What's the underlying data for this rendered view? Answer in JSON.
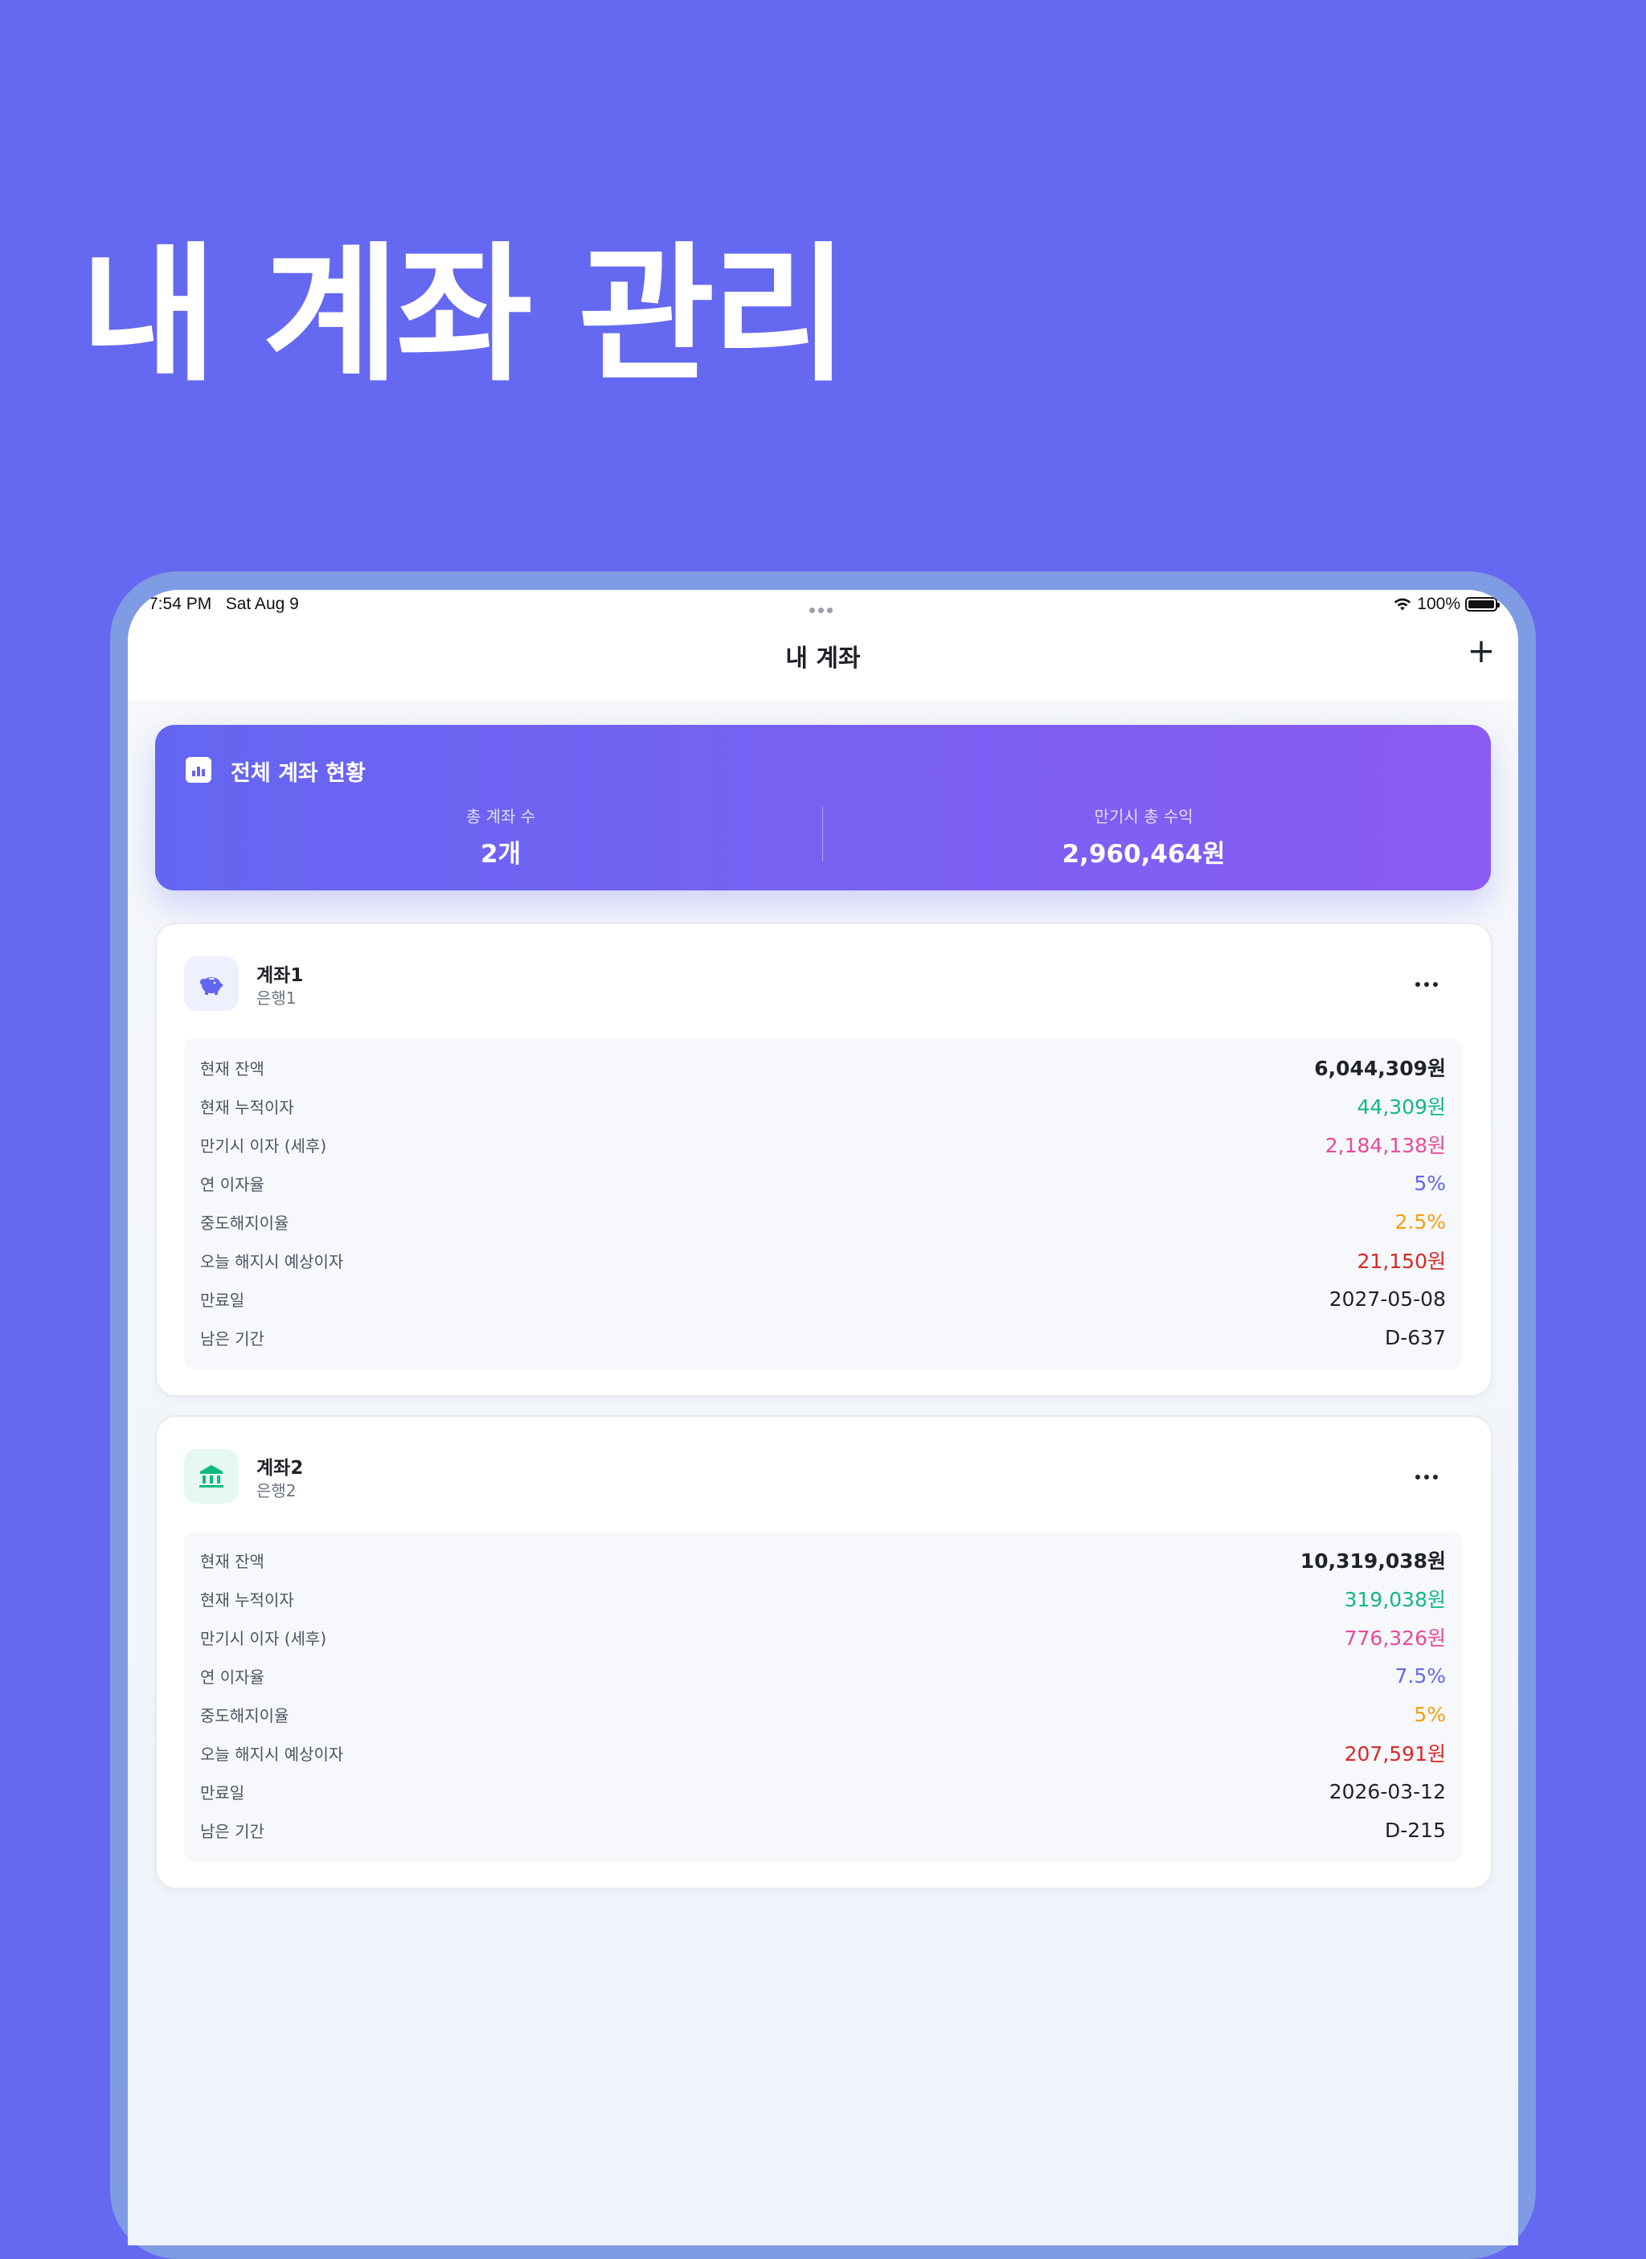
{
  "headline": "내 계좌 관리",
  "status_bar": {
    "time": "7:54 PM",
    "date": "Sat Aug 9",
    "battery": "100%"
  },
  "nav": {
    "title": "내 계좌",
    "add_label": "+"
  },
  "summary": {
    "title": "전체 계좌 현황",
    "total_accounts_label": "총 계좌 수",
    "total_accounts_value": "2개",
    "total_profit_label": "만기시 총 수익",
    "total_profit_value": "2,960,464원"
  },
  "accounts": [
    {
      "name": "계좌1",
      "bank": "은행1",
      "icon": "piggy-bank-icon",
      "rows": [
        {
          "label": "현재 잔액",
          "value": "6,044,309원"
        },
        {
          "label": "현재 누적이자",
          "value": "44,309원"
        },
        {
          "label": "만기시 이자 (세후)",
          "value": "2,184,138원"
        },
        {
          "label": "연 이자율",
          "value": "5%"
        },
        {
          "label": "중도해지이율",
          "value": "2.5%"
        },
        {
          "label": "오늘 해지시 예상이자",
          "value": "21,150원"
        },
        {
          "label": "만료일",
          "value": "2027-05-08"
        },
        {
          "label": "남은 기간",
          "value": "D-637"
        }
      ]
    },
    {
      "name": "계좌2",
      "bank": "은행2",
      "icon": "bank-building-icon",
      "rows": [
        {
          "label": "현재 잔액",
          "value": "10,319,038원"
        },
        {
          "label": "현재 누적이자",
          "value": "319,038원"
        },
        {
          "label": "만기시 이자 (세후)",
          "value": "776,326원"
        },
        {
          "label": "연 이자율",
          "value": "7.5%"
        },
        {
          "label": "중도해지이율",
          "value": "5%"
        },
        {
          "label": "오늘 해지시 예상이자",
          "value": "207,591원"
        },
        {
          "label": "만료일",
          "value": "2026-03-12"
        },
        {
          "label": "남은 기간",
          "value": "D-215"
        }
      ]
    }
  ],
  "colors": {
    "background": "#6568F1",
    "accent": "#6366F1",
    "interest": "#10B981",
    "maturity_interest": "#EC4899",
    "rate": "#6366F1",
    "early_rate": "#F59E0B",
    "today_interest": "#DC2626"
  }
}
